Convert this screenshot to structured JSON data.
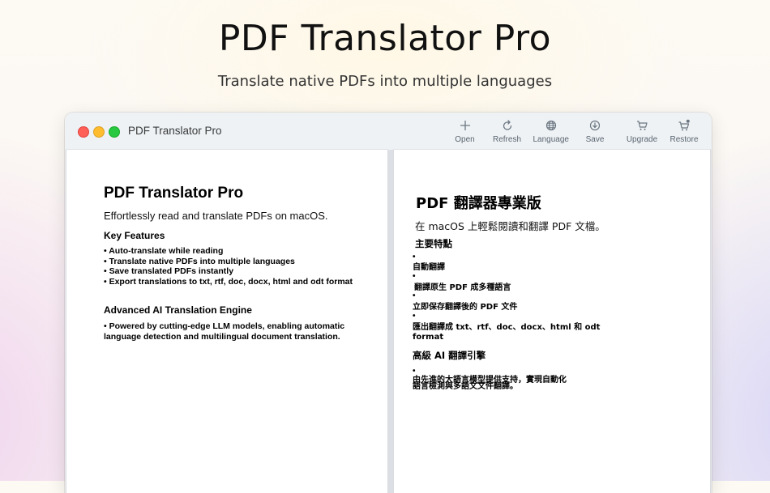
{
  "hero": {
    "title": "PDF Translator Pro",
    "subtitle": "Translate native PDFs into multiple languages"
  },
  "window": {
    "title": "PDF Translator Pro",
    "toolbar": [
      {
        "icon": "plus-icon",
        "label": "Open"
      },
      {
        "icon": "refresh-icon",
        "label": "Refresh"
      },
      {
        "icon": "globe-icon",
        "label": "Language"
      },
      {
        "icon": "download-circle-icon",
        "label": "Save"
      },
      {
        "icon": "cart-icon",
        "label": "Upgrade"
      },
      {
        "icon": "cart-restore-icon",
        "label": "Restore"
      }
    ]
  },
  "original": {
    "title": "PDF Translator Pro",
    "intro": "Effortlessly read and translate PDFs on macOS.",
    "features_heading": "Key Features",
    "features": [
      "• Auto-translate while reading",
      "• Translate native PDFs into multiple languages",
      "• Save translated PDFs instantly",
      "• Export translations to txt, rtf, doc, docx, html and odt format"
    ],
    "engine_heading": "Advanced AI Translation Engine",
    "engine_text": "• Powered by cutting-edge LLM models, enabling automatic language detection and multilingual document translation."
  },
  "translated": {
    "title": "PDF 翻譯器專業版",
    "intro": "在 macOS 上輕鬆閱讀和翻譯 PDF 文檔。",
    "features_heading": "主要特點",
    "bullet": "•",
    "features": [
      "自動翻譯",
      "翻譯原生 PDF 成多種語言",
      "立即保存翻譯後的 PDF 文件",
      "匯出翻譯成 txt、rtf、doc、docx、html 和 odt"
    ],
    "features_tail": "format",
    "engine_heading": "高級 AI 翻譯引擎",
    "engine_line1": "由先進的大語言模型提供支持，實現自動化",
    "engine_line2": "語言檢測與多語文文件翻譯。"
  },
  "colors": {
    "close": "#fe5f57",
    "minimize": "#febc2e",
    "zoom": "#28c840"
  }
}
